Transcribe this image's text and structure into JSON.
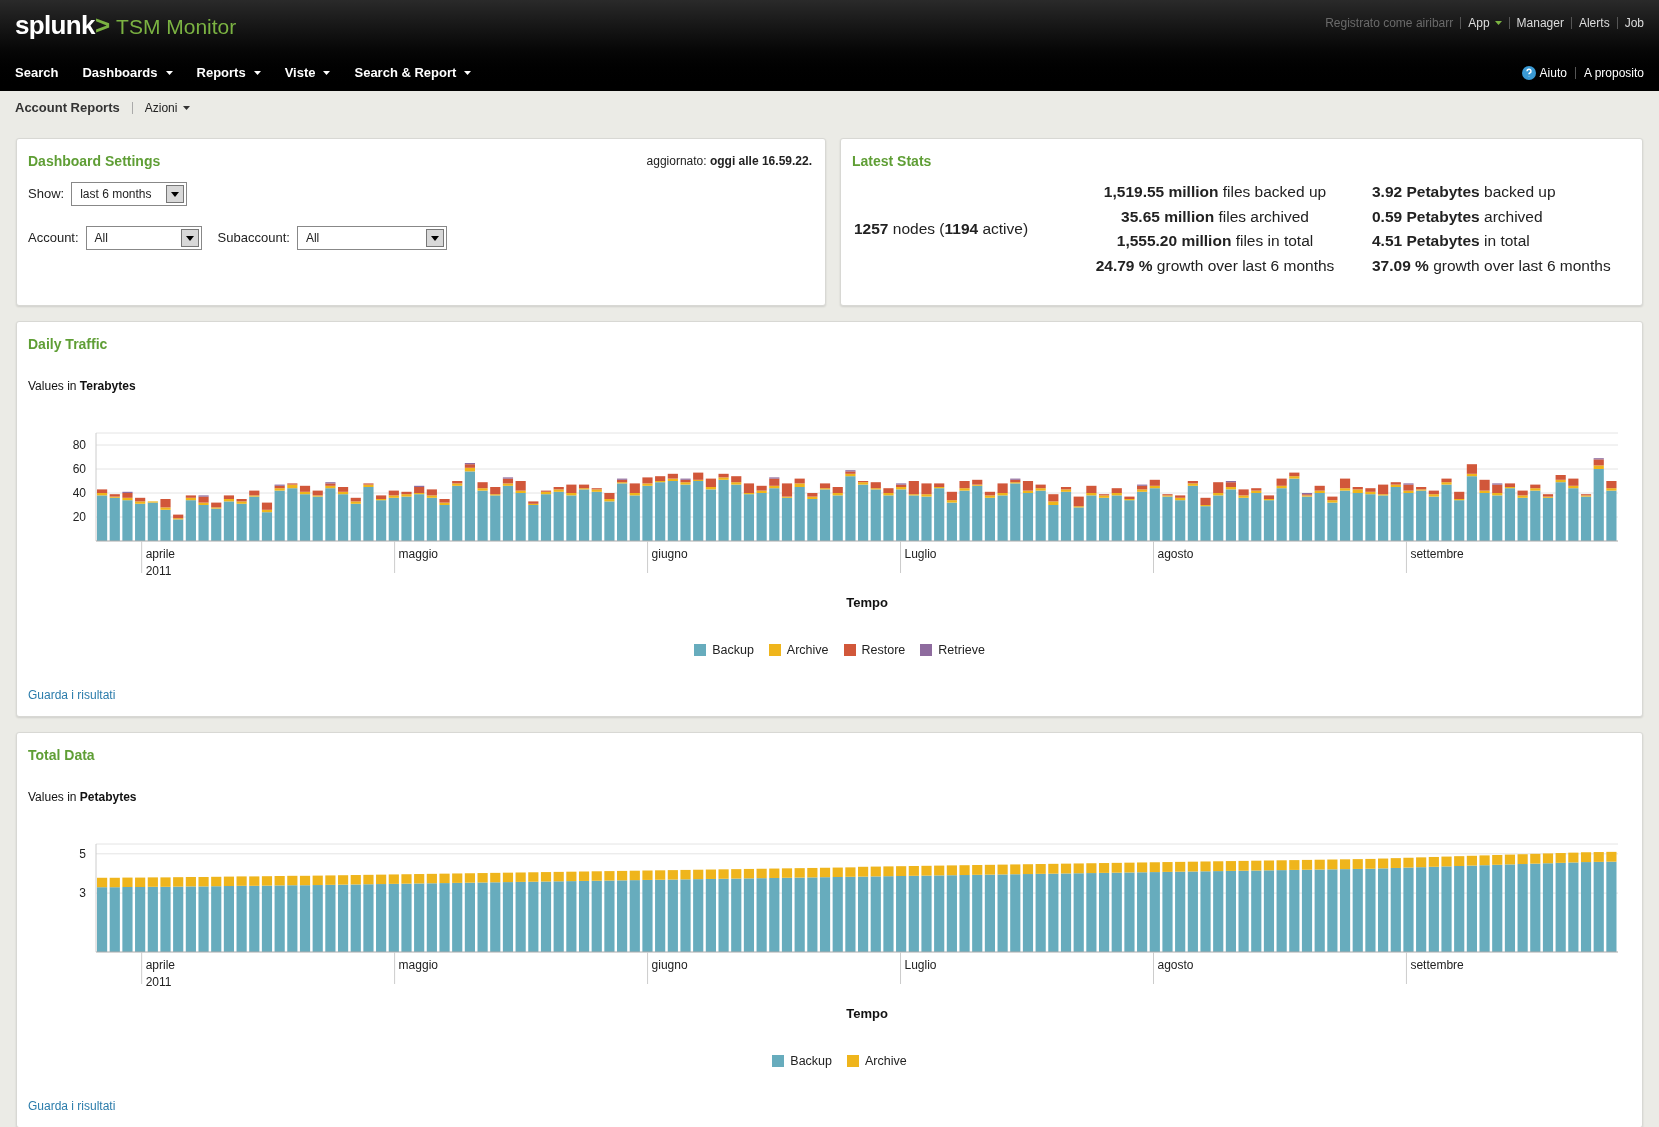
{
  "header": {
    "logo": {
      "text": "splunk",
      "mark": ">"
    },
    "app_name": "TSM Monitor",
    "user_links": [
      {
        "label": "Registrato come airibarr",
        "kind": "status",
        "dropdown": false
      },
      {
        "label": "App",
        "kind": "link",
        "dropdown": true
      },
      {
        "label": "Manager",
        "kind": "link",
        "dropdown": false
      },
      {
        "label": "Alerts",
        "kind": "link",
        "dropdown": false
      },
      {
        "label": "Job",
        "kind": "link",
        "dropdown": false
      }
    ],
    "nav": [
      {
        "label": "Search",
        "dropdown": false
      },
      {
        "label": "Dashboards",
        "dropdown": true
      },
      {
        "label": "Reports",
        "dropdown": true
      },
      {
        "label": "Viste",
        "dropdown": true
      },
      {
        "label": "Search & Report",
        "dropdown": true
      }
    ],
    "help_links": [
      {
        "label": "Aiuto",
        "kind": "help"
      },
      {
        "label": "A proposito",
        "kind": "link"
      }
    ]
  },
  "breadcrumb": {
    "title": "Account Reports",
    "actions": "Azioni"
  },
  "settings": {
    "title": "Dashboard Settings",
    "updated": "aggiornato: **oggi alle 16.59.22.**",
    "fields": [
      {
        "label": "Show:",
        "value": "last 6 months"
      },
      {
        "label": "Account:",
        "value": "All"
      },
      {
        "label": "Subaccount:",
        "value": "All"
      }
    ]
  },
  "stats": {
    "title": "Latest Stats",
    "nodes": "**1257** nodes (**1194** active)",
    "files": [
      "**1,519.55 million** files backed up",
      "**35.65 million** files archived",
      "**1,555.20 million** files in total",
      "**24.79 %** growth over last 6 months"
    ],
    "data": [
      "**3.92 Petabytes** backed up",
      "**0.59 Petabytes** archived",
      "**4.51 Petabytes** in total",
      "**37.09 %** growth over last 6 months"
    ]
  },
  "panels": [
    {
      "title": "Daily Traffic",
      "subtitle": "Values in **Terabytes**",
      "link": "Guarda i risultati",
      "months": [
        {
          "label": "aprile",
          "year": "2011"
        },
        {
          "label": "maggio"
        },
        {
          "label": "giugno"
        },
        {
          "label": "Luglio"
        },
        {
          "label": "agosto"
        },
        {
          "label": "settembre"
        }
      ],
      "chart_data": {
        "type": "bar",
        "stacked": true,
        "grid": true,
        "xlabel": "Tempo",
        "ylim": [
          0,
          90
        ],
        "yticks": [
          20,
          40,
          60,
          80
        ],
        "series": [
          {
            "name": "Backup",
            "color": "#67acbd",
            "values": [
              38,
              36,
              34,
              31,
              32,
              26,
              18,
              34,
              30,
              27,
              33,
              31,
              37,
              24,
              42,
              44,
              39,
              37,
              44,
              39,
              31,
              45,
              34,
              36,
              37,
              39,
              36,
              30,
              46,
              58,
              42,
              38,
              46,
              40,
              30,
              39,
              41,
              38,
              43,
              41,
              33,
              48,
              38,
              46,
              49,
              50,
              47,
              50,
              43,
              51,
              47,
              39,
              40,
              44,
              36,
              45,
              35,
              43,
              38,
              54,
              47,
              43,
              38,
              43,
              38,
              37,
              44,
              32,
              42,
              46,
              36,
              38,
              48,
              40,
              42,
              30,
              41,
              28,
              38,
              36,
              38,
              34,
              41,
              44,
              37,
              34,
              46,
              29,
              38,
              43,
              36,
              40,
              34,
              44,
              52,
              37,
              40,
              32,
              42,
              40,
              39,
              38,
              45,
              40,
              42,
              37,
              47,
              34,
              54,
              40,
              38,
              44,
              36,
              42,
              36,
              49,
              44,
              37,
              60,
              42
            ]
          },
          {
            "name": "Archive",
            "color": "#efb51c",
            "values": [
              2,
              1,
              2,
              2,
              1,
              2,
              1,
              2,
              2,
              1,
              2,
              2,
              1,
              2,
              2,
              3,
              2,
              1,
              2,
              2,
              2,
              2,
              1,
              2,
              2,
              1,
              2,
              2,
              2,
              3,
              2,
              1,
              2,
              2,
              1,
              2,
              2,
              2,
              1,
              2,
              2,
              1,
              2,
              2,
              1,
              2,
              2,
              1,
              2,
              2,
              2,
              1,
              2,
              2,
              1,
              3,
              2,
              1,
              2,
              2,
              2,
              1,
              2,
              2,
              1,
              2,
              1,
              2,
              2,
              1,
              2,
              2,
              1,
              2,
              2,
              3,
              2,
              1,
              2,
              2,
              2,
              1,
              2,
              2,
              1,
              2,
              2,
              1,
              2,
              2,
              2,
              2,
              1,
              2,
              2,
              1,
              2,
              2,
              2,
              3,
              2,
              1,
              2,
              2,
              1,
              2,
              2,
              1,
              2,
              2,
              2,
              1,
              2,
              2,
              1,
              2,
              2,
              1,
              3,
              2
            ]
          },
          {
            "name": "Restore",
            "color": "#d1573a",
            "values": [
              3,
              2,
              4,
              3,
              0,
              7,
              3,
              2,
              5,
              4,
              3,
              2,
              4,
              6,
              2,
              1,
              5,
              4,
              2,
              4,
              3,
              1,
              3,
              4,
              2,
              5,
              5,
              3,
              2,
              3,
              5,
              6,
              4,
              8,
              2,
              1,
              2,
              7,
              3,
              1,
              5,
              2,
              8,
              5,
              4,
              4,
              2,
              6,
              7,
              3,
              5,
              8,
              4,
              6,
              11,
              4,
              3,
              4,
              5,
              2,
              1,
              5,
              4,
              2,
              11,
              9,
              3,
              7,
              6,
              4,
              3,
              8,
              2,
              8,
              3,
              6,
              2,
              8,
              6,
              1,
              4,
              2,
              3,
              5,
              1,
              2,
              2,
              6,
              9,
              4,
              5,
              2,
              3,
              6,
              3,
              1,
              4,
              3,
              8,
              2,
              3,
              8,
              2,
              5,
              2,
              3,
              3,
              6,
              8,
              9,
              7,
              3,
              4,
              3,
              2,
              4,
              6,
              1,
              5,
              6
            ]
          },
          {
            "name": "Retrieve",
            "color": "#8e6b9e",
            "values": [
              0,
              0,
              1,
              0,
              0,
              0,
              0,
              0,
              1,
              0,
              0,
              0,
              0,
              0,
              1,
              0,
              0,
              0,
              1,
              0,
              0,
              0,
              0,
              0,
              0,
              1,
              0,
              0,
              0,
              1,
              0,
              0,
              1,
              0,
              0,
              0,
              0,
              0,
              0,
              0,
              0,
              1,
              0,
              0,
              0,
              0,
              1,
              0,
              0,
              0,
              0,
              0,
              0,
              1,
              0,
              0,
              0,
              0,
              0,
              1,
              0,
              0,
              0,
              1,
              0,
              0,
              0,
              0,
              0,
              0,
              0,
              0,
              1,
              0,
              0,
              0,
              0,
              0,
              0,
              0,
              0,
              0,
              1,
              0,
              0,
              0,
              0,
              0,
              0,
              1,
              0,
              0,
              0,
              0,
              0,
              1,
              0,
              0,
              0,
              0,
              0,
              0,
              0,
              1,
              0,
              0,
              0,
              0,
              0,
              0,
              1,
              0,
              0,
              0,
              0,
              0,
              0,
              0,
              1,
              0
            ]
          }
        ]
      }
    },
    {
      "title": "Total Data",
      "subtitle": "Values in **Petabytes**",
      "link": "Guarda i risultati",
      "months": [
        {
          "label": "aprile",
          "year": "2011"
        },
        {
          "label": "maggio"
        },
        {
          "label": "giugno"
        },
        {
          "label": "Luglio"
        },
        {
          "label": "agosto"
        },
        {
          "label": "settembre"
        }
      ],
      "chart_data": {
        "type": "bar",
        "stacked": true,
        "grid": true,
        "xlabel": "Tempo",
        "ylim": [
          0,
          5.5
        ],
        "yticks": [
          3,
          5
        ],
        "series": [
          {
            "name": "Backup",
            "color": "#67acbd",
            "values": [
              3.3,
              3.3,
              3.31,
              3.31,
              3.32,
              3.32,
              3.33,
              3.34,
              3.34,
              3.35,
              3.36,
              3.37,
              3.37,
              3.38,
              3.39,
              3.4,
              3.4,
              3.41,
              3.42,
              3.43,
              3.44,
              3.45,
              3.46,
              3.47,
              3.48,
              3.49,
              3.5,
              3.51,
              3.52,
              3.53,
              3.54,
              3.55,
              3.56,
              3.57,
              3.58,
              3.59,
              3.6,
              3.61,
              3.62,
              3.63,
              3.64,
              3.65,
              3.66,
              3.67,
              3.68,
              3.69,
              3.7,
              3.71,
              3.72,
              3.73,
              3.74,
              3.75,
              3.76,
              3.77,
              3.78,
              3.79,
              3.8,
              3.81,
              3.82,
              3.83,
              3.84,
              3.85,
              3.86,
              3.87,
              3.88,
              3.89,
              3.9,
              3.91,
              3.92,
              3.93,
              3.94,
              3.95,
              3.96,
              3.97,
              3.98,
              3.99,
              4.0,
              4.01,
              4.02,
              4.03,
              4.04,
              4.05,
              4.06,
              4.07,
              4.08,
              4.09,
              4.1,
              4.11,
              4.12,
              4.13,
              4.14,
              4.15,
              4.16,
              4.17,
              4.18,
              4.19,
              4.2,
              4.21,
              4.22,
              4.23,
              4.24,
              4.26,
              4.28,
              4.3,
              4.32,
              4.34,
              4.36,
              4.38,
              4.4,
              4.42,
              4.44,
              4.46,
              4.48,
              4.5,
              4.52,
              4.54,
              4.56,
              4.58,
              4.59,
              4.6
            ]
          },
          {
            "name": "Archive",
            "color": "#efb51c",
            "values": [
              0.48,
              0.48,
              0.48,
              0.48,
              0.48,
              0.48,
              0.48,
              0.48,
              0.48,
              0.48,
              0.48,
              0.48,
              0.48,
              0.48,
              0.48,
              0.48,
              0.48,
              0.48,
              0.48,
              0.48,
              0.48,
              0.48,
              0.48,
              0.48,
              0.48,
              0.48,
              0.48,
              0.48,
              0.48,
              0.48,
              0.48,
              0.48,
              0.48,
              0.48,
              0.48,
              0.48,
              0.48,
              0.48,
              0.48,
              0.48,
              0.48,
              0.48,
              0.48,
              0.48,
              0.48,
              0.48,
              0.48,
              0.48,
              0.48,
              0.48,
              0.48,
              0.48,
              0.48,
              0.48,
              0.48,
              0.48,
              0.48,
              0.48,
              0.48,
              0.48,
              0.5,
              0.5,
              0.5,
              0.5,
              0.5,
              0.5,
              0.5,
              0.5,
              0.5,
              0.5,
              0.5,
              0.5,
              0.5,
              0.5,
              0.5,
              0.5,
              0.5,
              0.5,
              0.5,
              0.5,
              0.5,
              0.5,
              0.5,
              0.5,
              0.5,
              0.5,
              0.5,
              0.5,
              0.5,
              0.5,
              0.5,
              0.5,
              0.5,
              0.5,
              0.5,
              0.5,
              0.5,
              0.5,
              0.5,
              0.5,
              0.5,
              0.5,
              0.5,
              0.5,
              0.5,
              0.5,
              0.5,
              0.5,
              0.5,
              0.5,
              0.5,
              0.5,
              0.5,
              0.5,
              0.5,
              0.5,
              0.5,
              0.5,
              0.5,
              0.5
            ]
          }
        ]
      }
    }
  ]
}
